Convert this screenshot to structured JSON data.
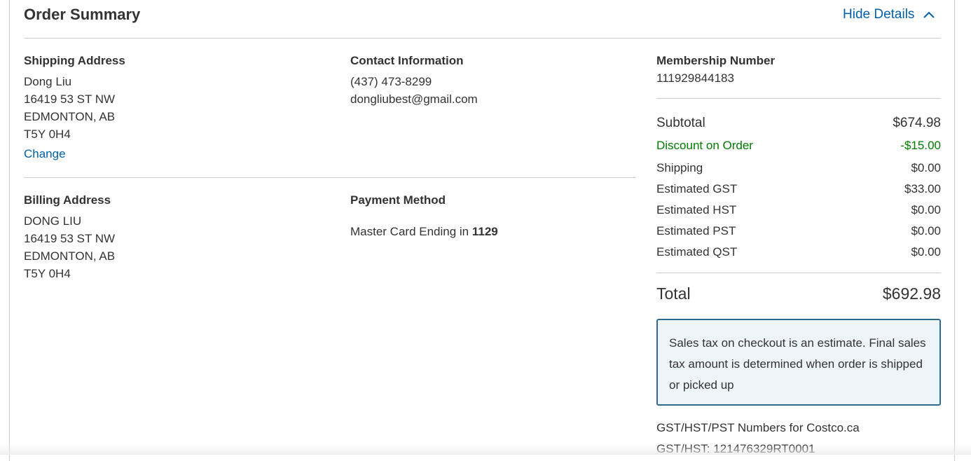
{
  "header": {
    "title": "Order Summary",
    "hide_details": "Hide Details"
  },
  "shipping": {
    "label": "Shipping Address",
    "lines": [
      "Dong Liu",
      "16419 53 ST NW",
      "EDMONTON, AB",
      "T5Y 0H4"
    ],
    "change": "Change"
  },
  "contact": {
    "label": "Contact Information",
    "phone": "(437) 473-8299",
    "email": "dongliubest@gmail.com"
  },
  "membership": {
    "label": "Membership Number",
    "number": "111929844183"
  },
  "billing": {
    "label": "Billing Address",
    "lines": [
      "DONG LIU",
      "16419 53 ST NW",
      "EDMONTON, AB",
      "T5Y 0H4"
    ]
  },
  "payment": {
    "label": "Payment Method",
    "text": "Master Card Ending in",
    "last4": "1129"
  },
  "summary": {
    "subtotal": {
      "label": "Subtotal",
      "value": "$674.98"
    },
    "discount": {
      "label": "Discount on Order",
      "value": "-$15.00"
    },
    "shipping": {
      "label": "Shipping",
      "value": "$0.00"
    },
    "gst": {
      "label": "Estimated GST",
      "value": "$33.00"
    },
    "hst": {
      "label": "Estimated HST",
      "value": "$0.00"
    },
    "pst": {
      "label": "Estimated PST",
      "value": "$0.00"
    },
    "qst": {
      "label": "Estimated QST",
      "value": "$0.00"
    },
    "total": {
      "label": "Total",
      "value": "$692.98"
    }
  },
  "note": "Sales tax on checkout is an estimate. Final sales tax amount is determined when order is shipped or picked up",
  "tax_numbers": {
    "heading": "GST/HST/PST Numbers for Costco.ca",
    "gst_hst": "GST/HST: 121476329RT0001"
  },
  "colors": {
    "link": "#0060a9",
    "discount": "#007a00",
    "note_border": "#2e6b8f",
    "note_bg": "#eef5f9"
  },
  "icons": {
    "hide_details": "chevron-up-icon"
  }
}
